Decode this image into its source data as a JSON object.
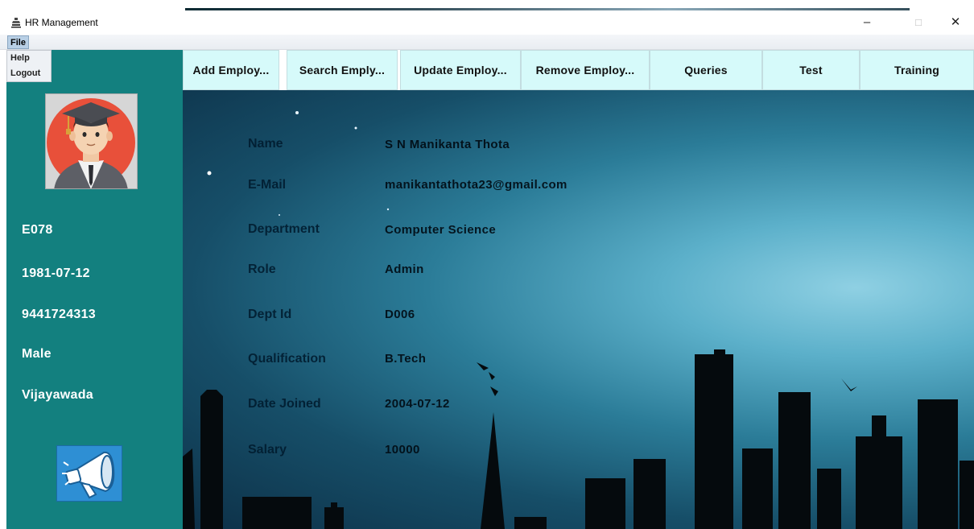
{
  "window": {
    "title": "HR Management"
  },
  "menu": {
    "file": "File",
    "items": [
      "Help",
      "Logout"
    ]
  },
  "toolbar": [
    "Add Employ...",
    "Search Emply...",
    "Update Employ...",
    "Remove Employ...",
    "Queries",
    "Test",
    "Training"
  ],
  "profile": {
    "id": "E078",
    "dob": "1981-07-12",
    "phone": "9441724313",
    "gender": "Male",
    "city": "Vijayawada"
  },
  "details": [
    {
      "label": "Name",
      "value": "S N Manikanta  Thota"
    },
    {
      "label": "E-Mail",
      "value": "manikantathota23@gmail.com"
    },
    {
      "label": "Department",
      "value": "Computer Science"
    },
    {
      "label": "Role",
      "value": "Admin"
    },
    {
      "label": "Dept Id",
      "value": "D006"
    },
    {
      "label": "Qualification",
      "value": "B.Tech"
    },
    {
      "label": "Date Joined",
      "value": "2004-07-12"
    },
    {
      "label": "Salary",
      "value": "10000"
    }
  ],
  "icons": {
    "app": "app-icon",
    "avatar": "graduate-avatar-icon",
    "announce": "megaphone-icon"
  },
  "colors": {
    "sidebar": "#13807f",
    "toolbar_button": "#d6fafa"
  }
}
